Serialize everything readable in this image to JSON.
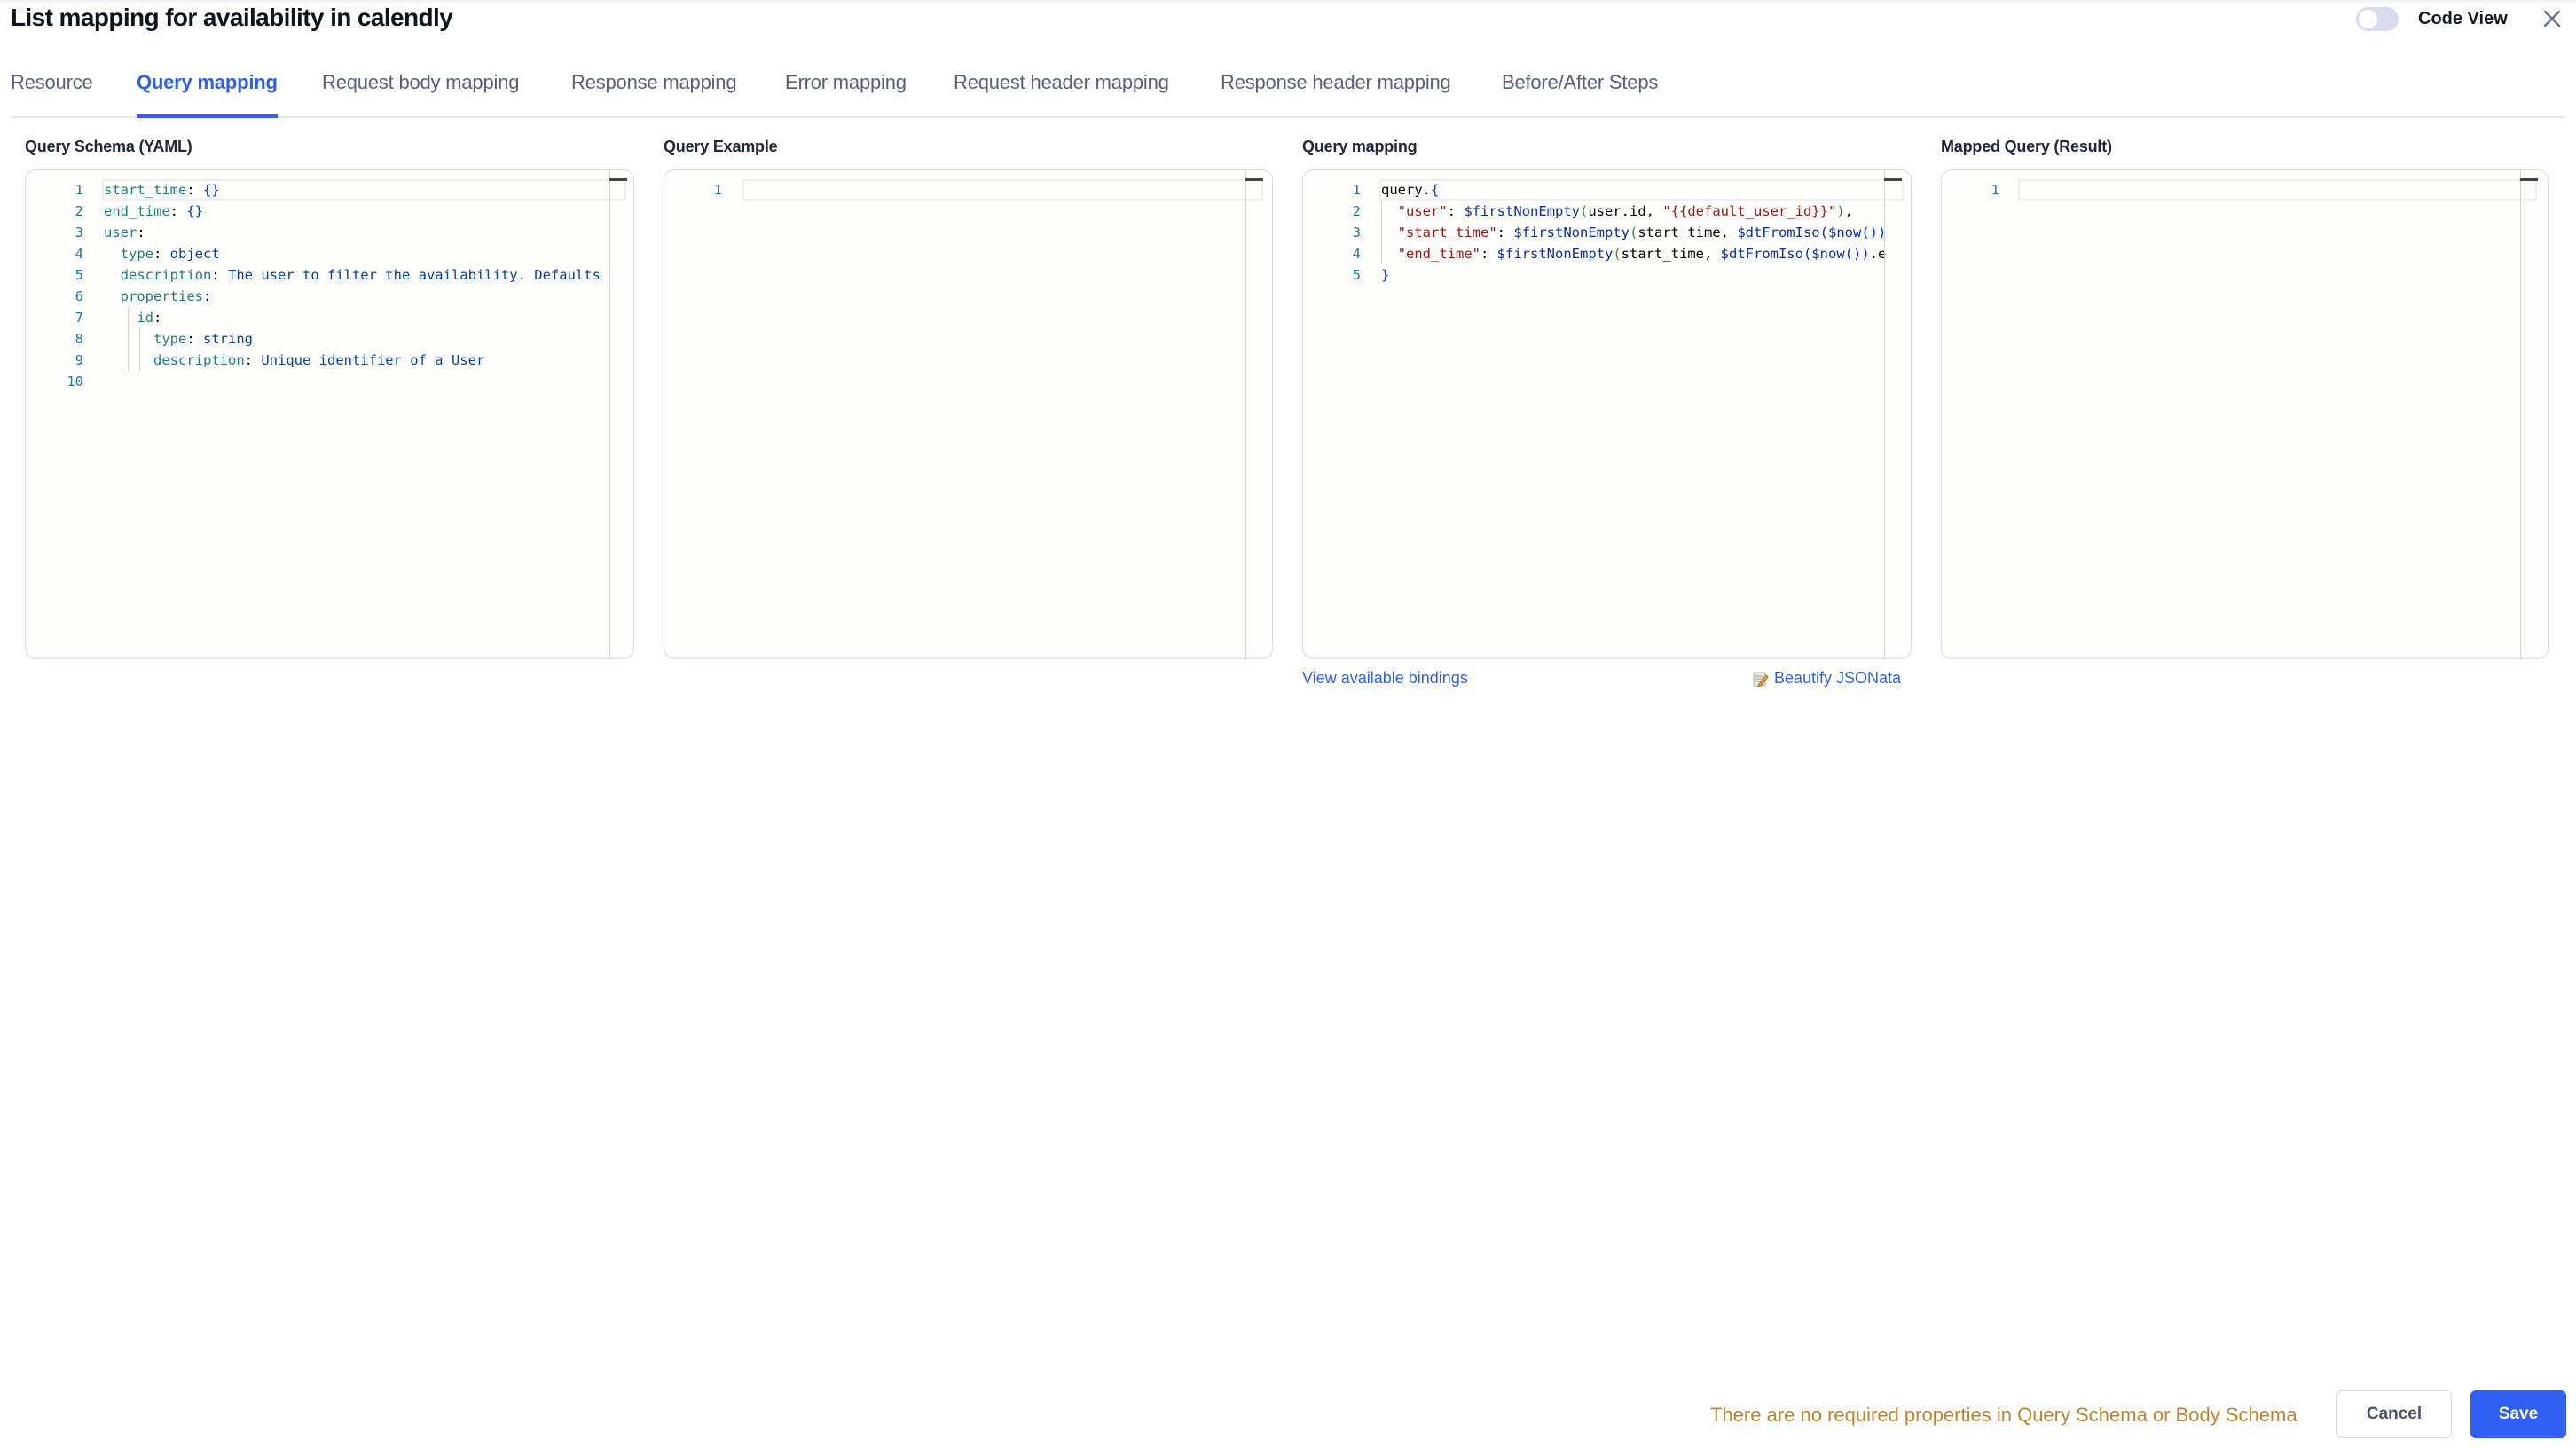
{
  "header": {
    "title": "List mapping for availability in calendly",
    "code_view_label": "Code View",
    "code_view_enabled": false
  },
  "tabs": [
    {
      "label": "Resource",
      "active": false
    },
    {
      "label": "Query mapping",
      "active": true
    },
    {
      "label": "Request body mapping",
      "active": false
    },
    {
      "label": "Response mapping",
      "active": false
    },
    {
      "label": "Error mapping",
      "active": false
    },
    {
      "label": "Request header mapping",
      "active": false
    },
    {
      "label": "Response header mapping",
      "active": false
    },
    {
      "label": "Before/After Steps",
      "active": false
    }
  ],
  "panels": {
    "schema": {
      "label": "Query Schema (YAML)",
      "lines": [
        {
          "n": "1",
          "tokens": [
            [
              "k-yaml",
              "start_time"
            ],
            [
              "p",
              ": "
            ],
            [
              "br",
              "{}"
            ]
          ]
        },
        {
          "n": "2",
          "tokens": [
            [
              "k-yaml",
              "end_time"
            ],
            [
              "p",
              ": "
            ],
            [
              "br",
              "{}"
            ]
          ]
        },
        {
          "n": "3",
          "tokens": [
            [
              "k-yaml",
              "user"
            ],
            [
              "p",
              ":"
            ]
          ]
        },
        {
          "n": "4",
          "tokens": [
            [
              "plain",
              "  "
            ],
            [
              "k-yaml",
              "type"
            ],
            [
              "p",
              ": "
            ],
            [
              "v-yaml",
              "object"
            ]
          ]
        },
        {
          "n": "5",
          "tokens": [
            [
              "plain",
              "  "
            ],
            [
              "k-yaml",
              "description"
            ],
            [
              "p",
              ": "
            ],
            [
              "v-yaml",
              "The user to filter the availability. Defaults"
            ]
          ]
        },
        {
          "n": "6",
          "tokens": [
            [
              "plain",
              "  "
            ],
            [
              "k-yaml",
              "properties"
            ],
            [
              "p",
              ":"
            ]
          ]
        },
        {
          "n": "7",
          "tokens": [
            [
              "plain",
              "    "
            ],
            [
              "k-yaml",
              "id"
            ],
            [
              "p",
              ":"
            ]
          ]
        },
        {
          "n": "8",
          "tokens": [
            [
              "plain",
              "      "
            ],
            [
              "k-yaml",
              "type"
            ],
            [
              "p",
              ": "
            ],
            [
              "v-yaml",
              "string"
            ]
          ]
        },
        {
          "n": "9",
          "tokens": [
            [
              "plain",
              "      "
            ],
            [
              "k-yaml",
              "description"
            ],
            [
              "p",
              ": "
            ],
            [
              "v-yaml",
              "Unique identifier of a User"
            ]
          ]
        },
        {
          "n": "10",
          "tokens": []
        }
      ]
    },
    "example": {
      "label": "Query Example",
      "lines": [
        {
          "n": "1",
          "tokens": []
        }
      ]
    },
    "mapping": {
      "label": "Query mapping",
      "lines": [
        {
          "n": "1",
          "tokens": [
            [
              "plain",
              "query."
            ],
            [
              "br",
              "{"
            ]
          ]
        },
        {
          "n": "2",
          "tokens": [
            [
              "plain",
              "  "
            ],
            [
              "str",
              "\"user\""
            ],
            [
              "plain",
              ": "
            ],
            [
              "fn",
              "$firstNonEmpty"
            ],
            [
              "paren",
              "("
            ],
            [
              "plain",
              "user.id, "
            ],
            [
              "str",
              "\"{{default_user_id}}\""
            ],
            [
              "paren",
              ")"
            ],
            [
              "plain",
              ","
            ]
          ]
        },
        {
          "n": "3",
          "tokens": [
            [
              "plain",
              "  "
            ],
            [
              "str",
              "\"start_time\""
            ],
            [
              "plain",
              ": "
            ],
            [
              "fn",
              "$firstNonEmpty"
            ],
            [
              "paren",
              "("
            ],
            [
              "plain",
              "start_time, "
            ],
            [
              "fn",
              "$dtFromIso"
            ],
            [
              "br",
              "("
            ],
            [
              "fn",
              "$now"
            ],
            [
              "br",
              "()"
            ],
            [
              "br",
              ")"
            ]
          ]
        },
        {
          "n": "4",
          "tokens": [
            [
              "plain",
              "  "
            ],
            [
              "str",
              "\"end_time\""
            ],
            [
              "plain",
              ": "
            ],
            [
              "fn",
              "$firstNonEmpty"
            ],
            [
              "paren",
              "("
            ],
            [
              "plain",
              "start_time, "
            ],
            [
              "fn",
              "$dtFromIso"
            ],
            [
              "br",
              "("
            ],
            [
              "fn",
              "$now"
            ],
            [
              "br",
              "()"
            ],
            [
              "br",
              ")"
            ],
            [
              "plain",
              ".e"
            ]
          ]
        },
        {
          "n": "5",
          "tokens": [
            [
              "br",
              "}"
            ]
          ]
        }
      ],
      "view_bindings_label": "View available bindings",
      "beautify_label": "Beautify JSONata"
    },
    "result": {
      "label": "Mapped Query (Result)",
      "lines": [
        {
          "n": "1",
          "tokens": []
        }
      ]
    }
  },
  "footer": {
    "message": "There are no required properties in Query Schema or Body Schema",
    "cancel_label": "Cancel",
    "save_label": "Save"
  },
  "colors": {
    "accent": "#3060f3",
    "warning_text": "#c1822b"
  }
}
